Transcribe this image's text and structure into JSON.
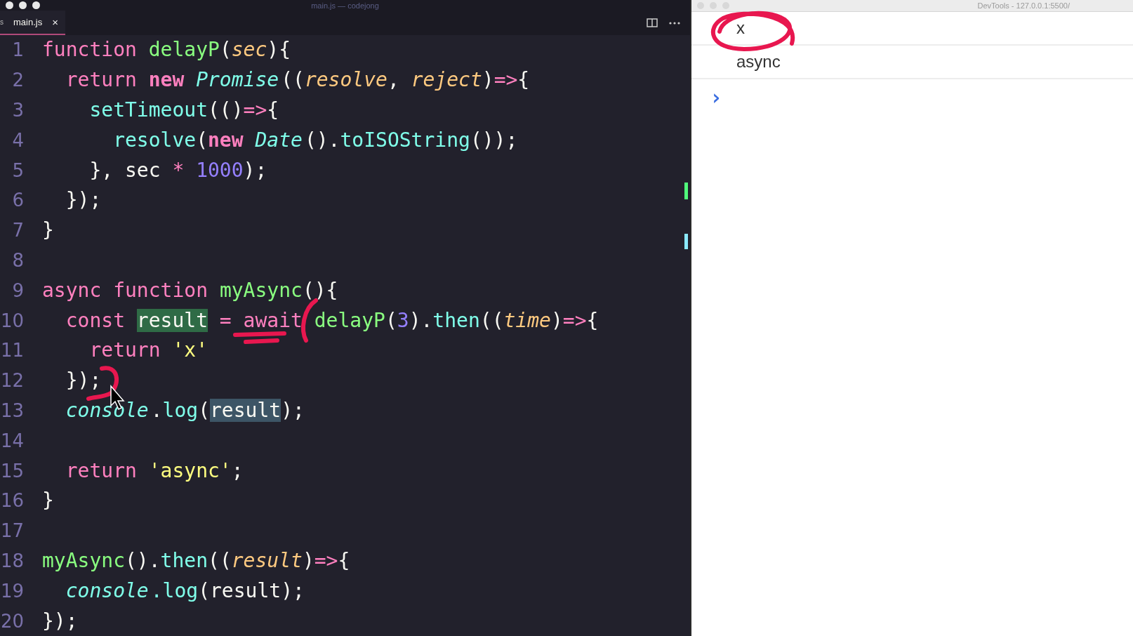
{
  "editor": {
    "title": "main.js — codejong",
    "tab": {
      "label": "main.js",
      "icon": "s",
      "close": "×",
      "selected": true
    },
    "lines": [
      {
        "n": "1",
        "tokens": [
          {
            "kind": "fn-kw",
            "t": "function "
          },
          {
            "kind": "fn",
            "t": "delayP"
          },
          {
            "kind": "plain",
            "t": "("
          },
          {
            "kind": "param",
            "t": "sec"
          },
          {
            "kind": "plain",
            "t": "){"
          }
        ]
      },
      {
        "n": "2",
        "tokens": [
          {
            "kind": "kw",
            "t": "  return "
          },
          {
            "kind": "kw-bold",
            "t": "new "
          },
          {
            "kind": "cls",
            "t": "Promise"
          },
          {
            "kind": "plain",
            "t": "(("
          },
          {
            "kind": "param",
            "t": "resolve"
          },
          {
            "kind": "plain",
            "t": ", "
          },
          {
            "kind": "param",
            "t": "reject"
          },
          {
            "kind": "plain",
            "t": ")"
          },
          {
            "kind": "op",
            "t": "=>"
          },
          {
            "kind": "plain",
            "t": "{"
          }
        ]
      },
      {
        "n": "3",
        "tokens": [
          {
            "kind": "call",
            "t": "    setTimeout"
          },
          {
            "kind": "plain",
            "t": "(()"
          },
          {
            "kind": "op",
            "t": "=>"
          },
          {
            "kind": "plain",
            "t": "{"
          }
        ]
      },
      {
        "n": "4",
        "tokens": [
          {
            "kind": "call",
            "t": "      resolve"
          },
          {
            "kind": "plain",
            "t": "("
          },
          {
            "kind": "kw-bold",
            "t": "new "
          },
          {
            "kind": "cls",
            "t": "Date"
          },
          {
            "kind": "plain",
            "t": "()."
          },
          {
            "kind": "call",
            "t": "toISOString"
          },
          {
            "kind": "plain",
            "t": "());"
          }
        ]
      },
      {
        "n": "5",
        "tokens": [
          {
            "kind": "plain",
            "t": "    }, sec "
          },
          {
            "kind": "op",
            "t": "* "
          },
          {
            "kind": "num",
            "t": "1000"
          },
          {
            "kind": "plain",
            "t": ");"
          }
        ]
      },
      {
        "n": "6",
        "tokens": [
          {
            "kind": "plain",
            "t": "  });"
          }
        ]
      },
      {
        "n": "7",
        "tokens": [
          {
            "kind": "plain",
            "t": "}"
          }
        ]
      },
      {
        "n": "8"
      },
      {
        "n": "9",
        "tokens": [
          {
            "kind": "fn-kw",
            "t": "async function "
          },
          {
            "kind": "fn",
            "t": "myAsync"
          },
          {
            "kind": "plain",
            "t": "(){"
          }
        ]
      },
      {
        "n": "10",
        "tokens": [
          {
            "kind": "kw",
            "t": "  const "
          },
          {
            "kind": "var-write",
            "t": "result"
          },
          {
            "kind": "op",
            "t": " = "
          },
          {
            "kind": "kw",
            "t": "await "
          },
          {
            "kind": "fn",
            "t": "delayP"
          },
          {
            "kind": "plain",
            "t": "("
          },
          {
            "kind": "num",
            "t": "3"
          },
          {
            "kind": "plain",
            "t": ")."
          },
          {
            "kind": "call",
            "t": "then"
          },
          {
            "kind": "plain",
            "t": "(("
          },
          {
            "kind": "param",
            "t": "time"
          },
          {
            "kind": "plain",
            "t": ")"
          },
          {
            "kind": "op",
            "t": "=>"
          },
          {
            "kind": "plain",
            "t": "{"
          }
        ]
      },
      {
        "n": "11",
        "tokens": [
          {
            "kind": "kw",
            "t": "    return "
          },
          {
            "kind": "str",
            "t": "'x'"
          }
        ]
      },
      {
        "n": "12",
        "tokens": [
          {
            "kind": "plain",
            "t": "  });"
          }
        ]
      },
      {
        "n": "13",
        "tokens": [
          {
            "kind": "cls",
            "t": "  console"
          },
          {
            "kind": "plain",
            "t": "."
          },
          {
            "kind": "call",
            "t": "log"
          },
          {
            "kind": "plain",
            "t": "("
          },
          {
            "kind": "var-read",
            "t": "result"
          },
          {
            "kind": "plain",
            "t": ");"
          }
        ]
      },
      {
        "n": "14"
      },
      {
        "n": "15",
        "tokens": [
          {
            "kind": "kw",
            "t": "  return "
          },
          {
            "kind": "str",
            "t": "'async'"
          },
          {
            "kind": "plain",
            "t": ";"
          }
        ]
      },
      {
        "n": "16",
        "tokens": [
          {
            "kind": "plain",
            "t": "}"
          }
        ]
      },
      {
        "n": "17"
      },
      {
        "n": "18",
        "tokens": [
          {
            "kind": "fn",
            "t": "myAsync"
          },
          {
            "kind": "plain",
            "t": "()."
          },
          {
            "kind": "call",
            "t": "then"
          },
          {
            "kind": "plain",
            "t": "(("
          },
          {
            "kind": "param",
            "t": "result"
          },
          {
            "kind": "plain",
            "t": ")"
          },
          {
            "kind": "op",
            "t": "=>"
          },
          {
            "kind": "plain",
            "t": "{"
          }
        ]
      },
      {
        "n": "19",
        "tokens": [
          {
            "kind": "cls",
            "t": "  console"
          },
          {
            "kind": "call",
            "t": ".log"
          },
          {
            "kind": "plain",
            "t": "(result);"
          }
        ]
      },
      {
        "n": "20",
        "tokens": [
          {
            "kind": "plain",
            "t": "});"
          }
        ]
      }
    ]
  },
  "devtools": {
    "title": "DevTools - 127.0.0.1:5500/",
    "messages": [
      "x",
      "async"
    ],
    "prompt": "›"
  }
}
